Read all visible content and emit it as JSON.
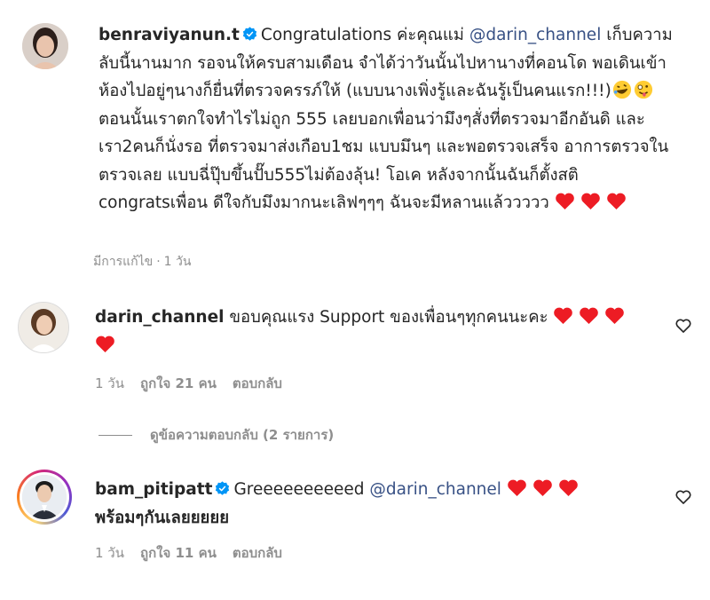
{
  "comments": [
    {
      "username": "benraviyanun.t",
      "verified": true,
      "text_start": "Congratulations ค่ะคุณแม่ ",
      "mention": "@darin_channel",
      "text_main": " เก็บความลับนี้นานมาก รอจนให้ครบสามเดือน จำได้ว่าวันนั้นไปหานางที่คอนโด พอเดินเข้าห้องไปอยู่ๆนางก็ยื่นที่ตรวจครรภ์ให้ (แบบนางเพิ่งรู้และฉันรู้เป็นคนแรก!!!)",
      "text_end": " ตอนนั้นเราตกใจทำไรไม่ถูก 555 เลยบอกเพื่อนว่ามึงๆสั่งที่ตรวจมาอีกอันดิ และเรา2คนก็นั่งรอ ที่ตรวจมาส่งเกือบ1ชม แบบมึนๆ และพอตรวจเสร็จ อาการตรวจในตรวจเลย แบบฉี่ปุ๊บขึ้นปั๊บ555ไม่ต้องลุ้น! โอเค หลังจากนั้นฉันก็ตั้งสติ congratsเพื่อน ดีใจกับมึงมากนะเลิฟๆๆๆ ฉันจะมีหลานแล้ววววว",
      "emojis": [
        "rofl-emoji",
        "zany-face-emoji"
      ],
      "hearts": 3,
      "edited": "มีการแก้ไข",
      "time": "1 วัน"
    },
    {
      "username": "darin_channel",
      "verified": false,
      "text": "ขอบคุณแรง Support ของเพื่อนๆทุกคนนะคะ",
      "hearts": 4,
      "time": "1 วัน",
      "likes": "ถูกใจ 21 คน",
      "reply": "ตอบกลับ"
    },
    {
      "username": "bam_pitipatt",
      "verified": true,
      "text_start": "Greeeeeeeeeed ",
      "mention": "@darin_channel",
      "hearts": 3,
      "text_end": "พร้อมๆกันเลยยยยย",
      "time": "1 วัน",
      "likes": "ถูกใจ 11 คน",
      "reply": "ตอบกลับ"
    }
  ],
  "view_replies": "ดูข้อความตอบกลับ (2 รายการ)",
  "colors": {
    "heart": "#ed1c24",
    "verified": "#0095f6",
    "mention": "#385185",
    "meta": "#8e8e8e"
  }
}
